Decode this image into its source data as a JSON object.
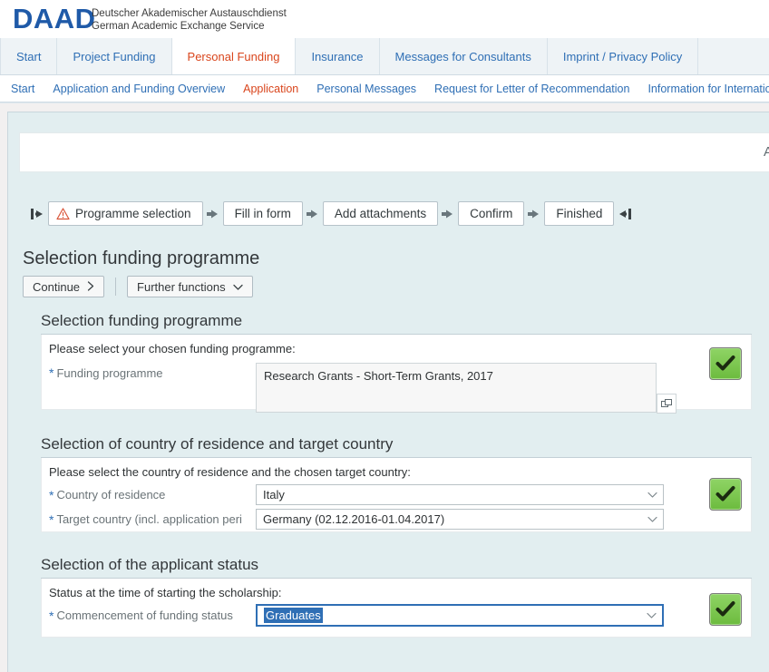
{
  "brand": {
    "logo": "DAAD",
    "subtitle_line1": "Deutscher Akademischer Austauschdienst",
    "subtitle_line2": "German Academic Exchange Service",
    "logo_color": "#1f5aa8"
  },
  "nav_primary": {
    "items": [
      {
        "label": "Start",
        "active": false
      },
      {
        "label": "Project Funding",
        "active": false
      },
      {
        "label": "Personal Funding",
        "active": true
      },
      {
        "label": "Insurance",
        "active": false
      },
      {
        "label": "Messages for Consultants",
        "active": false
      },
      {
        "label": "Imprint / Privacy Policy",
        "active": false
      }
    ],
    "link_color": "#2f6fb5",
    "active_color": "#d9451c"
  },
  "nav_secondary": {
    "items": [
      {
        "label": "Start",
        "active": false
      },
      {
        "label": "Application and Funding Overview",
        "active": false
      },
      {
        "label": "Application",
        "active": true
      },
      {
        "label": "Personal Messages",
        "active": false
      },
      {
        "label": "Request for Letter of Recommendation",
        "active": false
      },
      {
        "label": "Information for International",
        "active": false
      }
    ]
  },
  "header_strip": {
    "clipped_text": "A"
  },
  "roadmap": {
    "steps": [
      {
        "label": "Programme selection",
        "current": true,
        "warning": true
      },
      {
        "label": "Fill in form",
        "current": false,
        "warning": false
      },
      {
        "label": "Add attachments",
        "current": false,
        "warning": false
      },
      {
        "label": "Confirm",
        "current": false,
        "warning": false
      },
      {
        "label": "Finished",
        "current": false,
        "warning": false
      }
    ],
    "start_icon": "step-first-icon",
    "end_icon": "step-last-icon",
    "arrow_icon": "step-arrow-icon",
    "warning_icon": "warning-triangle-icon"
  },
  "page": {
    "title": "Selection funding programme"
  },
  "toolbar": {
    "continue_label": "Continue",
    "continue_icon": "chevron-right-icon",
    "further_functions_label": "Further functions",
    "further_functions_icon": "chevron-down-icon"
  },
  "sections": [
    {
      "title": "Selection funding programme",
      "intro": "Please select your chosen funding programme:",
      "field_label": "Funding programme",
      "required": true,
      "value": "Research Grants - Short-Term Grants, 2017",
      "value_help_icon": "value-help-icon",
      "status_icon": "green-check-icon"
    },
    {
      "title": "Selection of country of residence and target country",
      "intro": "Please select the country of residence and the chosen target country:",
      "rows": [
        {
          "label": "Country of residence",
          "required": true,
          "value": "Italy",
          "focused": false,
          "icon": "chevron-down-icon"
        },
        {
          "label": "Target country (incl. application period)",
          "label_clipped": "Target country (incl. application peri",
          "required": true,
          "value": "Germany (02.12.2016-01.04.2017)",
          "focused": false,
          "icon": "chevron-down-icon"
        }
      ],
      "status_icon": "green-check-icon"
    },
    {
      "title": "Selection of the applicant status",
      "intro": "Status at the time of starting the scholarship:",
      "rows": [
        {
          "label": "Commencement of funding status",
          "required": true,
          "value": "Graduates",
          "focused": true,
          "selected": true,
          "icon": "chevron-down-icon"
        }
      ],
      "status_icon": "green-check-icon"
    }
  ],
  "colors": {
    "accent_blue": "#2f6fb5",
    "accent_orange": "#d9451c",
    "canvas": "#e2eef0",
    "success_green": "#6cbb3e"
  }
}
